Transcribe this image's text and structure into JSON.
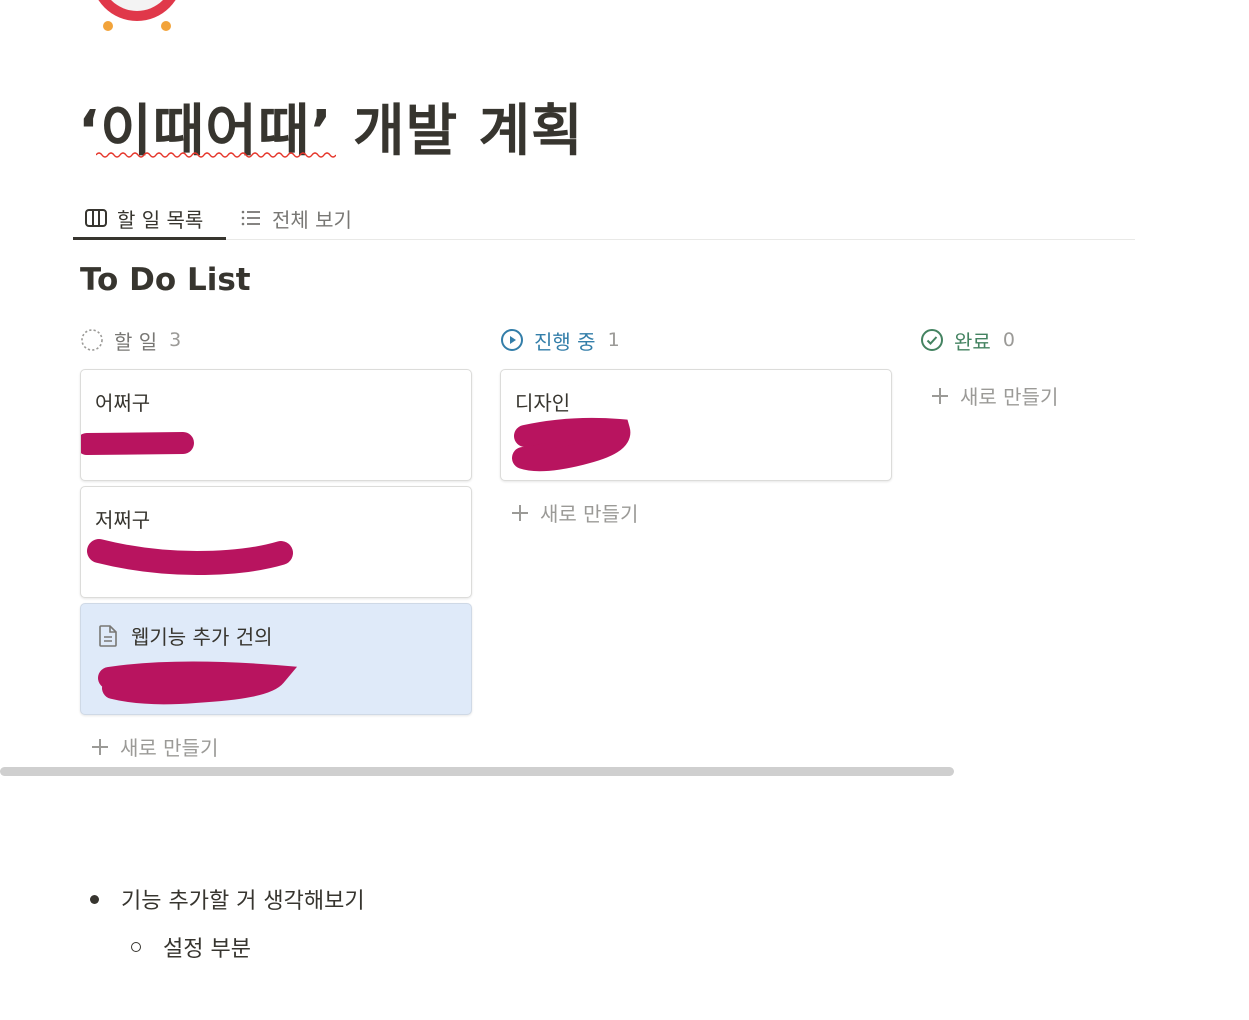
{
  "page": {
    "title": "‘이때어때’ 개발 계획",
    "icon": "alarm-clock-icon"
  },
  "tabs": [
    {
      "label": "할 일 목록",
      "icon": "board-icon",
      "active": true
    },
    {
      "label": "전체 보기",
      "icon": "list-icon",
      "active": false
    }
  ],
  "view_title": "To Do List",
  "columns": [
    {
      "label": "할 일",
      "count": "3",
      "color": "#9b9a97",
      "icon": "circle-dashed-icon",
      "cards": [
        {
          "title": "어쩌구"
        },
        {
          "title": "저쩌구"
        },
        {
          "title": "웹기능 추가 건의",
          "icon": "document-icon"
        }
      ],
      "new_label": "새로 만들기"
    },
    {
      "label": "진행 중",
      "count": "1",
      "color": "#337ea9",
      "icon": "play-circle-icon",
      "cards": [
        {
          "title": "디자인"
        }
      ],
      "new_label": "새로 만들기"
    },
    {
      "label": "완료",
      "count": "0",
      "color": "#448361",
      "icon": "check-circle-icon",
      "cards": [],
      "new_label": "새로 만들기"
    }
  ],
  "bullets": [
    {
      "text": "기능 추가할 거 생각해보기"
    },
    {
      "text": "설정 부분"
    }
  ],
  "colors": {
    "text": "#37352f",
    "muted": "#9b9a97",
    "redaction": "#b8145f",
    "selected_card": "#dfeaf9"
  }
}
